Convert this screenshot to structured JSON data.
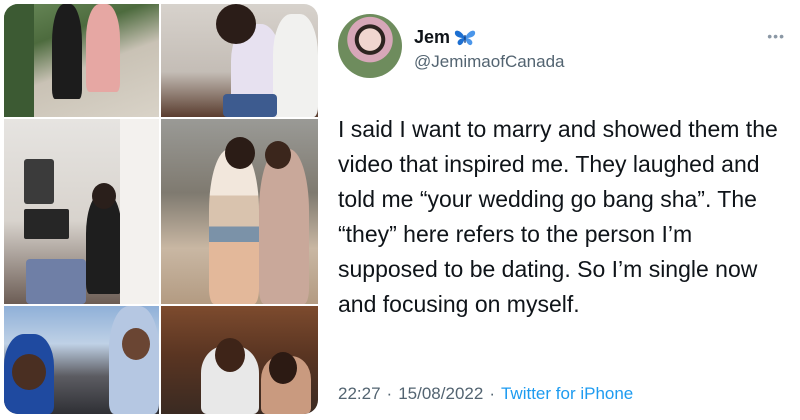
{
  "images": [
    {
      "name": "couple-outdoor-photo"
    },
    {
      "name": "couple-hug-photo"
    },
    {
      "name": "woman-selfie-photo"
    },
    {
      "name": "couple-kitchen-photo"
    },
    {
      "name": "couple-traditional-attire-photo"
    },
    {
      "name": "couple-restaurant-photo"
    }
  ],
  "tweet": {
    "display_name": "Jem",
    "handle": "@JemimaofCanada",
    "verified_emoji_icon": "butterfly-icon",
    "more_icon": "ellipsis-icon",
    "text": "I said I want to marry and showed them the video that inspired me. They laughed and told me “your wedding go bang sha”. The “they” here refers to the person I’m supposed to be dating. So I’m single now and focusing on myself.",
    "time": "22:27",
    "separator1": "·",
    "date": "15/08/2022",
    "separator2": "·",
    "source": "Twitter for iPhone"
  },
  "colors": {
    "text": "#0f1419",
    "secondary": "#536471",
    "link": "#1d9bf0",
    "butterfly": "#1d6fd1"
  }
}
